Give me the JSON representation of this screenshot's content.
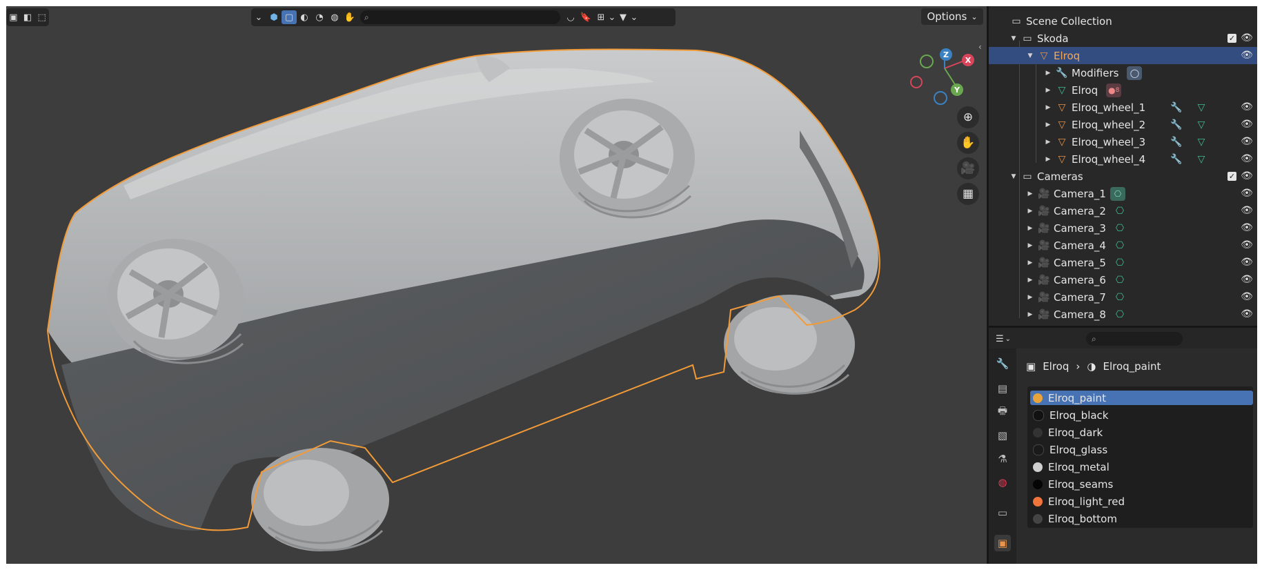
{
  "viewport": {
    "search_placeholder": "",
    "options_label": "Options",
    "gizmo": {
      "z": "Z",
      "x": "X",
      "y": "Y"
    }
  },
  "outliner": {
    "rows": [
      {
        "label": "Scene Collection",
        "type": "scene"
      },
      {
        "label": "Skoda",
        "type": "collection"
      },
      {
        "label": "Elroq",
        "type": "mesh-object",
        "selected": true
      },
      {
        "label": "Modifiers",
        "type": "modifiers"
      },
      {
        "label": "Elroq",
        "type": "mesh-data",
        "badge": "8"
      },
      {
        "label": "Elroq_wheel_1",
        "type": "mesh-object"
      },
      {
        "label": "Elroq_wheel_2",
        "type": "mesh-object"
      },
      {
        "label": "Elroq_wheel_3",
        "type": "mesh-object"
      },
      {
        "label": "Elroq_wheel_4",
        "type": "mesh-object"
      },
      {
        "label": "Cameras",
        "type": "collection"
      },
      {
        "label": "Camera_1",
        "type": "camera"
      },
      {
        "label": "Camera_2",
        "type": "camera"
      },
      {
        "label": "Camera_3",
        "type": "camera"
      },
      {
        "label": "Camera_4",
        "type": "camera"
      },
      {
        "label": "Camera_5",
        "type": "camera"
      },
      {
        "label": "Camera_6",
        "type": "camera"
      },
      {
        "label": "Camera_7",
        "type": "camera"
      },
      {
        "label": "Camera_8",
        "type": "camera"
      }
    ]
  },
  "properties": {
    "search_placeholder": "",
    "breadcrumb": {
      "object": "Elroq",
      "material": "Elroq_paint"
    },
    "materials": [
      {
        "name": "Elroq_paint",
        "color": "#e8a43a",
        "selected": true
      },
      {
        "name": "Elroq_black",
        "color": "#111111"
      },
      {
        "name": "Elroq_dark",
        "color": "#333333"
      },
      {
        "name": "Elroq_glass",
        "color": "#1a1a1a"
      },
      {
        "name": "Elroq_metal",
        "color": "#cfcfcf"
      },
      {
        "name": "Elroq_seams",
        "color": "#050505"
      },
      {
        "name": "Elroq_light_red",
        "color": "#f0753a"
      },
      {
        "name": "Elroq_bottom",
        "color": "#444444"
      }
    ]
  },
  "colors": {
    "accent": "#4772b3",
    "selection_outline": "#f29b38",
    "viewport_bg": "#3d3d3d"
  }
}
